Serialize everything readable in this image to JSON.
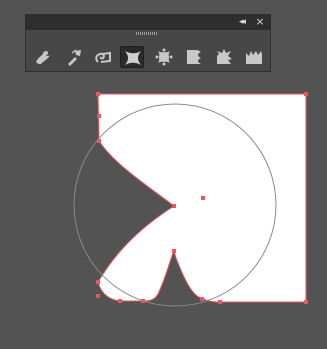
{
  "panel": {
    "collapse_label": "◂◂",
    "close_label": "×",
    "tools": [
      {
        "name": "twirl-tool",
        "icon": "twirl-icon"
      },
      {
        "name": "pucker-wand-tool",
        "icon": "pucker-wand-icon"
      },
      {
        "name": "spiral-tool",
        "icon": "spiral-icon"
      },
      {
        "name": "pucker-tool",
        "icon": "pucker-icon",
        "selected": true
      },
      {
        "name": "bloat-tool",
        "icon": "bloat-icon"
      },
      {
        "name": "scallop-tool",
        "icon": "scallop-icon"
      },
      {
        "name": "crystallize-tool",
        "icon": "crystallize-icon"
      },
      {
        "name": "wrinkle-tool",
        "icon": "wrinkle-icon"
      }
    ]
  },
  "colors": {
    "background": "#535353",
    "panel": "#474747",
    "panel_header": "#2e2e2e",
    "selection": "#e8565f",
    "shape_fill": "#ffffff",
    "brush_outline": "#8a8a8a"
  }
}
